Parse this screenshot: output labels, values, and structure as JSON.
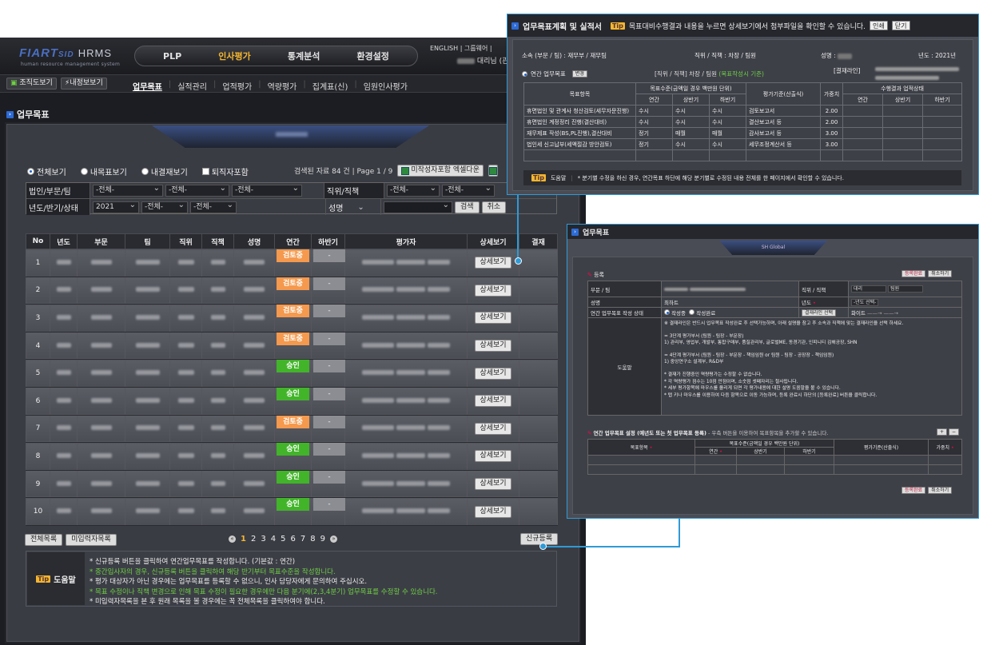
{
  "app": {
    "logo_brand": "FIART",
    "logo_sid": "SID",
    "logo_product": "HRMS",
    "logo_tagline": "human resource management system",
    "main_tabs": [
      "PLP",
      "인사평가",
      "통계분석",
      "환경설정"
    ],
    "active_tab": "인사평가",
    "top_links": "ENGLISH  |  그룹웨어  |",
    "user_label": "대리님 (관"
  },
  "subbar": {
    "org_button": "조직도보기",
    "info_button": "내정보보기",
    "nav": [
      "업무목표",
      "실적관리",
      "업적평가",
      "역량평가",
      "집계표(신)",
      "임원인사평가"
    ],
    "active_nav": "업무목표"
  },
  "page": {
    "title": "업무목표"
  },
  "filters": {
    "radios": [
      "전체보기",
      "내목표보기",
      "내결재보기"
    ],
    "selected_radio": "전체보기",
    "checkbox_label": "퇴직자포함",
    "search_info": "검색된 자료 84 건  |  Page 1 / 9",
    "excel_button": "미작성자포함 엑셀다운",
    "row1_label": "법인/부문/팀",
    "row1_selects": [
      "-전체-",
      "-전체-",
      "-전체-"
    ],
    "row1_label2": "직위/직책",
    "row1_selects2": [
      "-전체-",
      "-전체-"
    ],
    "row2_label": "년도/반기/상태",
    "row2_selects": [
      "2021",
      "-전체-",
      "-전체-"
    ],
    "row2_label2": "성명",
    "search_button": "검색",
    "cancel_button": "취소"
  },
  "table": {
    "headers": [
      "No",
      "년도",
      "부문",
      "팀",
      "직위",
      "직책",
      "성명",
      "연간",
      "하반기",
      "평가자",
      "상세보기",
      "결재"
    ],
    "rows": [
      {
        "no": "1",
        "annual": "검토중",
        "half": "-",
        "status": "review"
      },
      {
        "no": "2",
        "annual": "검토중",
        "half": "-",
        "status": "review"
      },
      {
        "no": "3",
        "annual": "검토중",
        "half": "-",
        "status": "review"
      },
      {
        "no": "4",
        "annual": "검토중",
        "half": "-",
        "status": "review"
      },
      {
        "no": "5",
        "annual": "승인",
        "half": "-",
        "status": "ok"
      },
      {
        "no": "6",
        "annual": "승인",
        "half": "-",
        "status": "ok"
      },
      {
        "no": "7",
        "annual": "검토중",
        "half": "-",
        "status": "review"
      },
      {
        "no": "8",
        "annual": "승인",
        "half": "-",
        "status": "ok"
      },
      {
        "no": "9",
        "annual": "승인",
        "half": "-",
        "status": "ok"
      },
      {
        "no": "10",
        "annual": "승인",
        "half": "-",
        "status": "ok"
      }
    ],
    "detail_label": "상세보기"
  },
  "bottom": {
    "all_list_button": "전체목록",
    "unentered_button": "미입력자목록",
    "pages": [
      "1",
      "2",
      "3",
      "4",
      "5",
      "6",
      "7",
      "8",
      "9"
    ],
    "current_page": "1",
    "new_button": "신규등록"
  },
  "help": {
    "tip": "Tip",
    "label": "도움말",
    "lines": [
      "* 신규등록 버튼을 클릭하여 연간업무목표를 작성합니다. (기본값 : 연간)",
      "* 중간입사자의 경우, 신규등록 버튼을 클릭하여 해당 반기부터 목표수준을 작성합니다.",
      "* 평가 대상자가 아닌 경우에는 업무목표를 등록할 수 없으니, 인사 담당자에게 문의하여 주십시오.",
      "* 목표 수정이나 직책 변경으로 인해 목표 수정이 필요한 경우에만 다음 분기에(2,3,4분기) 업무목표를 수정할 수 있습니다.",
      "* 미입력자목록을 본 후 원래 목록을 볼 경우에는 꼭 전체목록을 클릭하여야 합니다."
    ]
  },
  "win1": {
    "title": "업무목표계획 및 실적서",
    "tip_text": "목표대비수행결과 내용을 누르면 상세보기에서 첨부파일을 확인할 수 있습니다.",
    "print_button": "인쇄",
    "close_button": "닫기",
    "org_label": "소속 (부문 / 팀) : 재무부 / 재무팀",
    "pos_label": "직위 / 직책 : 차장 / 팀원",
    "name_label": "성명 :",
    "year_label": "년도 : 2021년",
    "annual_goal": "연간 업무목표",
    "change_button": "변경",
    "pos_note": "[직위 / 직책]  차장 / 팀원",
    "pos_note2": "(목표작성시 기준)",
    "approval_label": "[결재라인]",
    "headers": {
      "item": "목표항목",
      "level": "목표수준(금액일 경우 백만원 단위)",
      "level_sub": [
        "연간",
        "상반기",
        "하반기"
      ],
      "criteria": "평가기준(산출식)",
      "weight": "가중치",
      "result": "수행결과 업적상태",
      "result_sub": [
        "연간",
        "상반기",
        "하반기"
      ]
    },
    "rows": [
      {
        "item": "휴면법인 및 관계사 청산검토(세무자문진행)",
        "a": "수시",
        "h1": "수시",
        "h2": "수시",
        "crit": "검토보고서",
        "w": "2.00"
      },
      {
        "item": "휴면법인 계정정리 진행(결산대비)",
        "a": "수시",
        "h1": "수시",
        "h2": "수시",
        "crit": "결산보고서 등",
        "w": "2.00"
      },
      {
        "item": "재무제표 작성(BS,PL진행),결산대비",
        "a": "정기",
        "h1": "매월",
        "h2": "매월",
        "crit": "감사보고서 등",
        "w": "3.00"
      },
      {
        "item": "법인세 신고납부(세액절감 방안검토)",
        "a": "정기",
        "h1": "수시",
        "h2": "수시",
        "crit": "세무조정계산서 등",
        "w": "3.00"
      }
    ],
    "help_tip": "Tip",
    "help_label": "도움말",
    "help_text": "* 분기별 수정을 하신 경우, 연간목표 하단에 해당 분기별로 수정된 내용 전체를 한 페이지에서 확인할 수 있습니다."
  },
  "win2": {
    "title": "업무목표",
    "banner": "SH Global",
    "section": "등록",
    "save_button": "등록완료",
    "cancel_button": "취소하기",
    "dept_label": "부문 / 팀",
    "pos_label": "직위 / 직책",
    "pos_values": [
      "대리",
      "팀원"
    ],
    "name_label": "성명",
    "name_value": "최하트",
    "year_label": "년도",
    "year_select": "-년도 선택-",
    "state_label": "연간 업무목표 작성 상태",
    "state_options": [
      "작성중",
      "작성완료"
    ],
    "approval_button": "결재라인 선택",
    "white_label": "화이트",
    "help_label": "도움말",
    "help_lines": [
      "※ 결재라인은 반드시 업무목표 작성완료 후 선택가능하며, 아래 설명을 참고 후 소속과 직책에 맞는 결재라인을 선택 하세요.",
      "",
      "= 3단계 평가부서 (팀원 - 팀장 - 부문장)",
      "1) 관리부, 영업부, 개발부, 통합구매부, 품질관리부, 글로벌ME, 동경기관, 인피니티 김해공장, SHN",
      "",
      "= 4단계 평가부서 (팀원 - 팀장 - 부문장 - 책임임원  or  팀원 - 팀장 - 공장장 - 책임임원)",
      "1) 중앙연구소 설계부, R&D부",
      "",
      "* 결재가 진행중인 역량평가는 수정할 수 없습니다.",
      "* 각 역량평가 점수는 10점 만점이며, 소숫점 셋째자리는 절사됩니다.",
      "* 세부 평가항목에 마우스를 올리게 되면 각 평가내용에 대한 설명 도움말을 볼 수 있습니다.",
      "* 탭 키나 마우스를 이용하여 다음 항목으로 이동 가능하며, 등록 완료시 하단의 [등록완료] 버튼을 클릭합니다."
    ],
    "goal_section": "연간 업무목표 설정 (예년도 또는 첫 업무목표 등록)",
    "goal_note": "- 우측 버튼을 이용하여 목표항목을 추가할 수 있습니다.",
    "headers": {
      "item": "목표항목",
      "level": "목표수준(금액일 경우 백만원 단위)",
      "level_sub": [
        "연간",
        "상반기",
        "하반기"
      ],
      "criteria": "평가기준(산출식)",
      "weight": "가중치"
    }
  }
}
